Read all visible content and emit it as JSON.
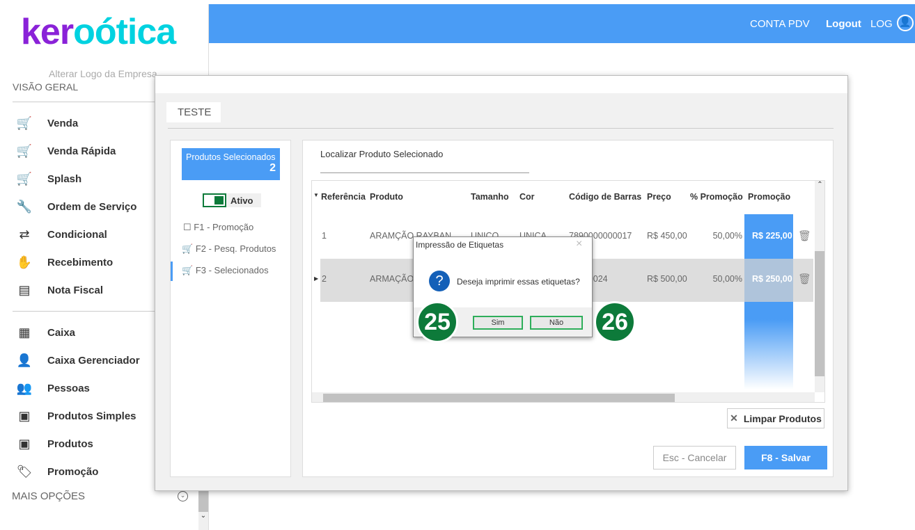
{
  "header": {
    "conta": "CONTA PDV",
    "logout": "Logout",
    "log": "LOG"
  },
  "sidebar": {
    "logo_a": "ker",
    "logo_b": "oótica",
    "change_logo": "Alterar Logo da Empresa",
    "section": "VISÃO GERAL",
    "more": "MAIS OPÇÕES",
    "items": [
      {
        "label": "Venda",
        "icon": "cart-icon"
      },
      {
        "label": "Venda Rápida",
        "icon": "cart-icon"
      },
      {
        "label": "Splash",
        "icon": "cart-dollar-icon"
      },
      {
        "label": "Ordem de Serviço",
        "icon": "wrench-icon"
      },
      {
        "label": "Condicional",
        "icon": "cart-arrows-icon"
      },
      {
        "label": "Recebimento",
        "icon": "hand-dollar-icon"
      },
      {
        "label": "Nota Fiscal",
        "icon": "nfe-icon"
      },
      {
        "label": "Caixa",
        "icon": "register-icon"
      },
      {
        "label": "Caixa Gerenciador",
        "icon": "user-dollar-icon"
      },
      {
        "label": "Pessoas",
        "icon": "people-icon"
      },
      {
        "label": "Produtos Simples",
        "icon": "box-icon"
      },
      {
        "label": "Produtos",
        "icon": "box-icon"
      },
      {
        "label": "Promoção",
        "icon": "tag-icon"
      }
    ]
  },
  "modal": {
    "title": "TESTE",
    "selected_label": "Produtos Selecionados",
    "selected_count": "2",
    "active_label": "Ativo",
    "steps": [
      "F1 - Promoção",
      "F2 - Pesq. Produtos",
      "F3 - Selecionados"
    ],
    "search_label": "Localizar Produto Selecionado",
    "columns": [
      "Referência",
      "Produto",
      "Tamanho",
      "Cor",
      "Código de Barras",
      "Preço",
      "% Promoção",
      "Promoção"
    ],
    "rows": [
      [
        "1",
        "ARAMÇÃO RAYBAN",
        "UNICO",
        "UNICA",
        "7890000000017",
        "R$ 450,00",
        "50,00%",
        "R$ 225,00"
      ],
      [
        "2",
        "ARMAÇÃO I",
        "",
        "",
        "00000024",
        "R$ 500,00",
        "50,00%",
        "R$ 250,00"
      ]
    ],
    "clear": "Limpar Produtos",
    "cancel": "Esc - Cancelar",
    "save": "F8 - Salvar"
  },
  "dialog": {
    "title": "Impressão de Etiquetas",
    "message": "Deseja imprimir essas etiquetas?",
    "yes": "Sim",
    "no": "Não",
    "badge_yes": "25",
    "badge_no": "26"
  },
  "colors": {
    "primary": "#4a9cf5",
    "badge": "#0d7a3a",
    "logo_purple": "#8a22d8",
    "logo_cyan": "#00d2e0"
  }
}
